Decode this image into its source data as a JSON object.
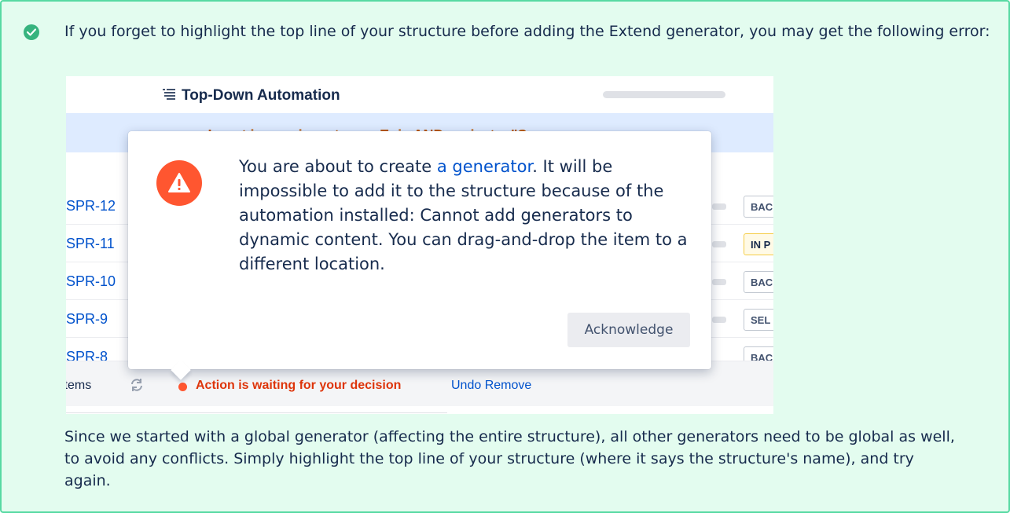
{
  "note": {
    "intro": "If you forget to highlight the top line of your structure before adding the Extend generator, you may get the following error:",
    "outro": "Since we started with a global generator (affecting the entire structure), all other generators need to be global as well, to avoid any conflicts. Simply highlight the top line of your structure (where it says the structure's name), and try again.",
    "icon": "check-circle-icon",
    "colors": {
      "background": "#e3fcef",
      "border": "#57d9a3",
      "icon": "#36b37e"
    }
  },
  "screenshot": {
    "title": "Top-Down Automation",
    "insert_text": "+ Insert issues issuetype = Epic AND project = \"S",
    "rows": [
      {
        "key": "SPR-12",
        "status": "BAC"
      },
      {
        "key": "SPR-11",
        "status": "IN P"
      },
      {
        "key": "SPR-10",
        "status": "BAC"
      },
      {
        "key": "SPR-9",
        "status": "SEL"
      },
      {
        "key": "SPR-8",
        "status": "BAC"
      }
    ],
    "footer": {
      "items_label": "items",
      "waiting_text": "Action is waiting for your decision",
      "undo_label": "Undo Remove"
    },
    "modal": {
      "message_before": "You are about to create ",
      "message_link": "a generator",
      "message_after": ". It will be impossible to add it to the structure because of the automation installed: Cannot add generators to dynamic content. You can drag-and-drop the item to a different location.",
      "button_label": "Acknowledge"
    },
    "colors": {
      "warning": "#ff5630",
      "link": "#0052cc",
      "waiting": "#de350b"
    }
  }
}
